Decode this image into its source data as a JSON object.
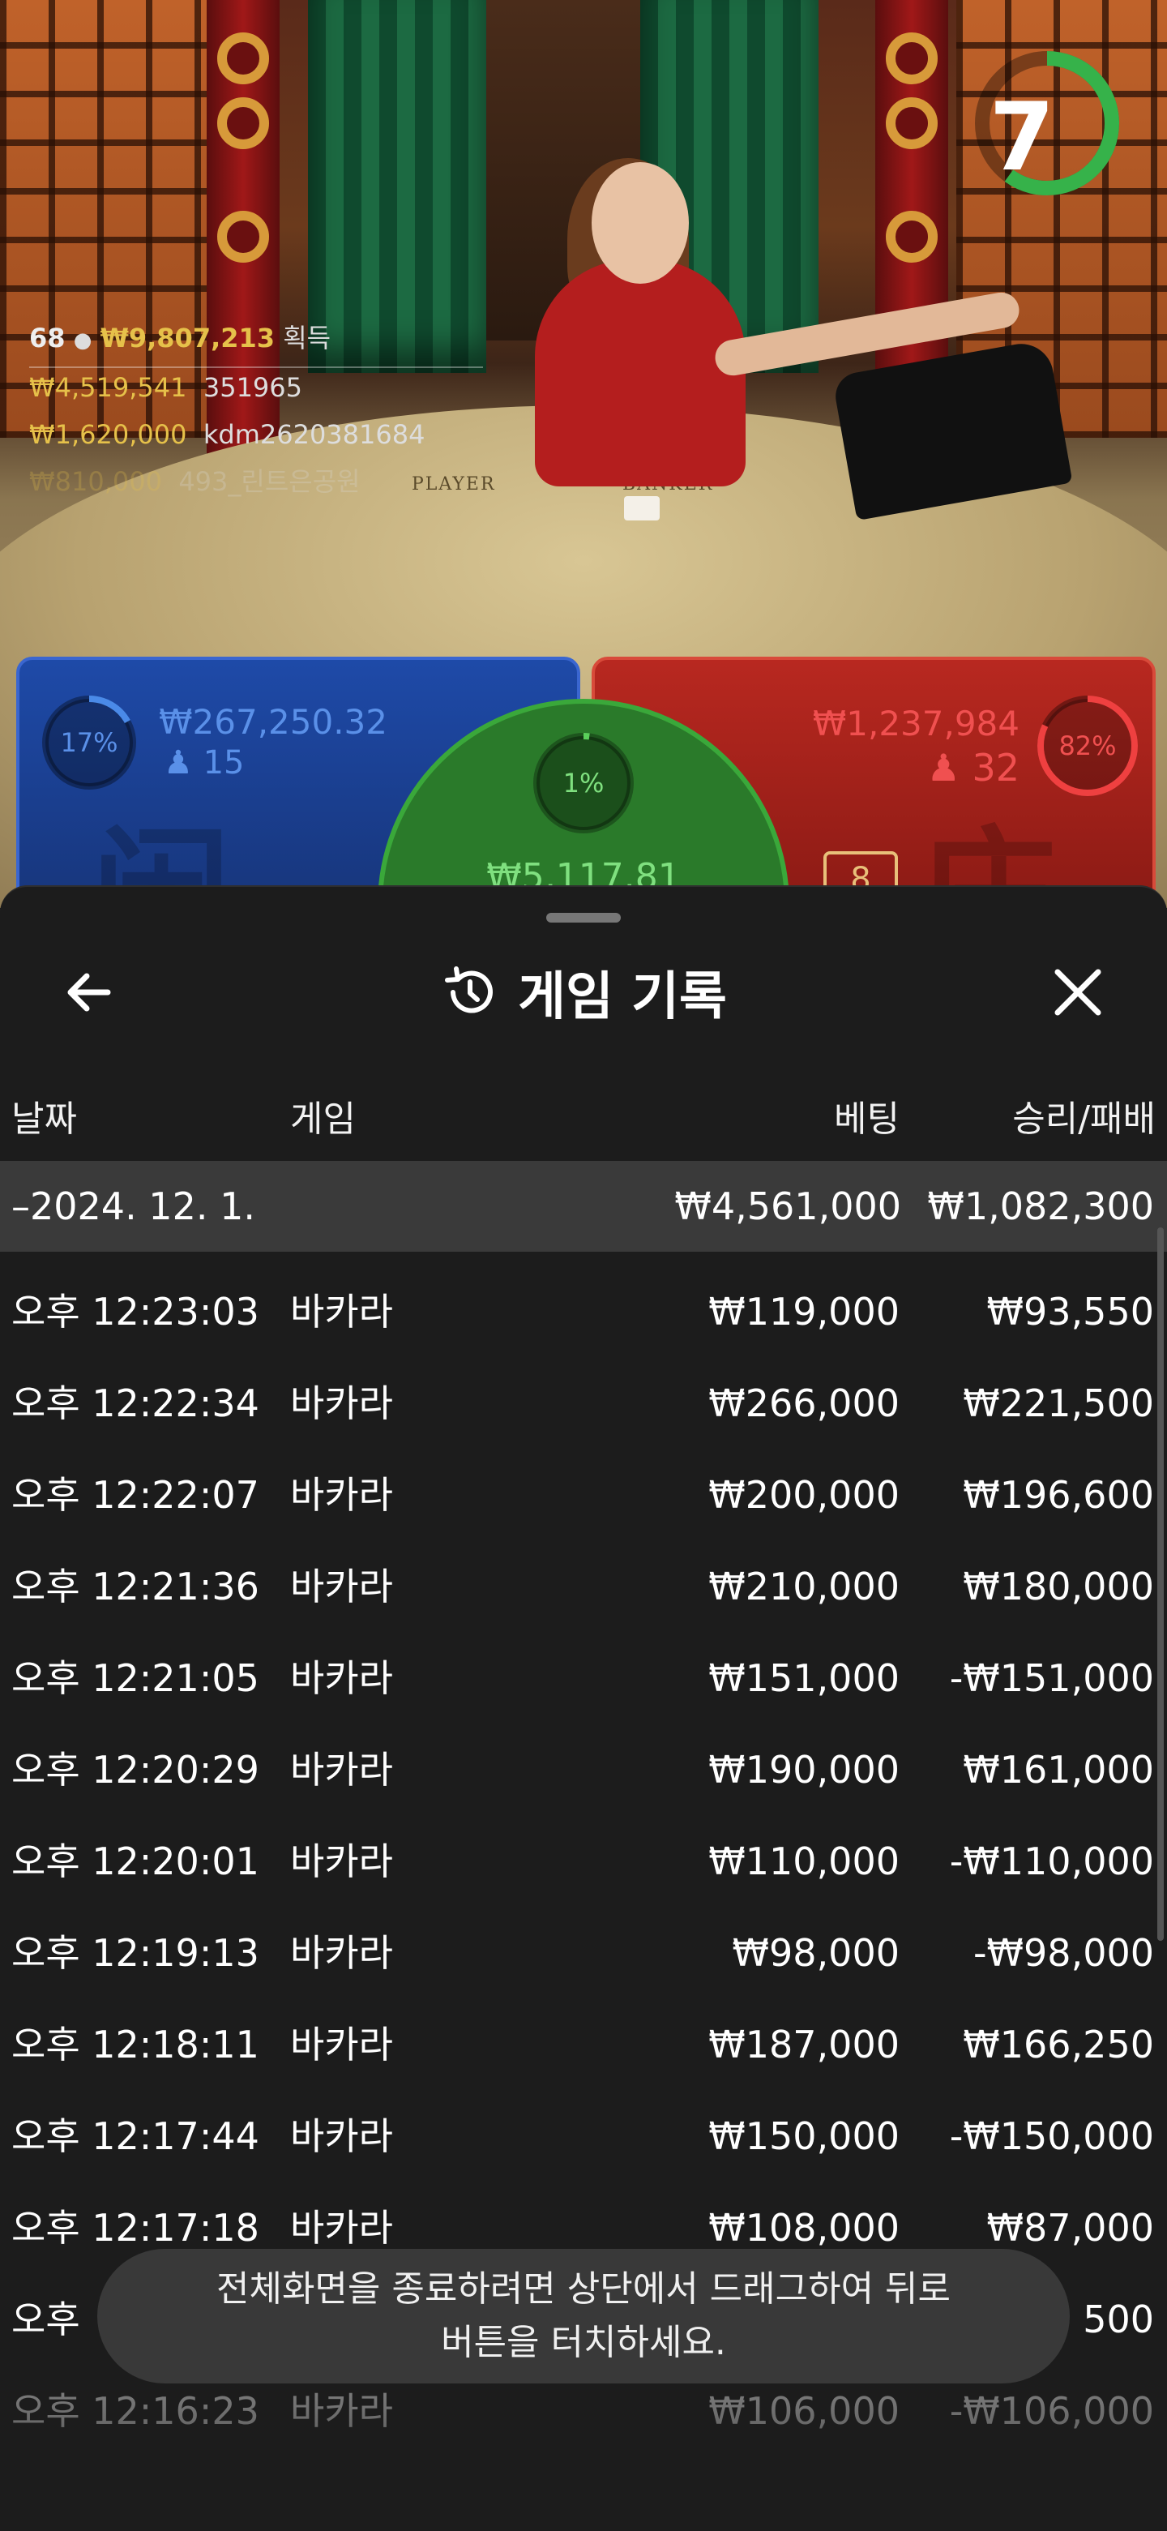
{
  "game_overlay": {
    "timer": "7",
    "timer_fraction": 0.6,
    "winners": {
      "count": "68",
      "total": "₩9,807,213",
      "label": "획득",
      "entries": [
        {
          "amount": "₩4,519,541",
          "name": "351965"
        },
        {
          "amount": "₩1,620,000",
          "name": "kdm2620381684"
        },
        {
          "amount": "₩810,000",
          "name": "493_린트은공원"
        }
      ]
    },
    "table_labels": {
      "player": "PLAYER",
      "banker": "BANKER"
    },
    "player": {
      "percent": "17%",
      "percent_value": 0.17,
      "amount": "₩267,250.32",
      "players": "15"
    },
    "tie": {
      "percent": "1%",
      "percent_value": 0.01,
      "amount": "₩5,117.81"
    },
    "banker": {
      "percent": "82%",
      "percent_value": 0.82,
      "amount": "₩1,237,984",
      "players": "32"
    }
  },
  "sheet": {
    "title": "게임 기록",
    "columns": {
      "date": "날짜",
      "game": "게임",
      "bet": "베팅",
      "result": "승리/패배"
    },
    "summary": {
      "date": "–2024. 12. 1.",
      "bet": "₩4,561,000",
      "result": "₩1,082,300"
    },
    "rows": [
      {
        "time": "오후 12:23:03",
        "game": "바카라",
        "bet": "₩119,000",
        "result": "₩93,550"
      },
      {
        "time": "오후 12:22:34",
        "game": "바카라",
        "bet": "₩266,000",
        "result": "₩221,500"
      },
      {
        "time": "오후 12:22:07",
        "game": "바카라",
        "bet": "₩200,000",
        "result": "₩196,600"
      },
      {
        "time": "오후 12:21:36",
        "game": "바카라",
        "bet": "₩210,000",
        "result": "₩180,000"
      },
      {
        "time": "오후 12:21:05",
        "game": "바카라",
        "bet": "₩151,000",
        "result": "-₩151,000"
      },
      {
        "time": "오후 12:20:29",
        "game": "바카라",
        "bet": "₩190,000",
        "result": "₩161,000"
      },
      {
        "time": "오후 12:20:01",
        "game": "바카라",
        "bet": "₩110,000",
        "result": "-₩110,000"
      },
      {
        "time": "오후 12:19:13",
        "game": "바카라",
        "bet": "₩98,000",
        "result": "-₩98,000"
      },
      {
        "time": "오후 12:18:11",
        "game": "바카라",
        "bet": "₩187,000",
        "result": "₩166,250"
      },
      {
        "time": "오후 12:17:44",
        "game": "바카라",
        "bet": "₩150,000",
        "result": "-₩150,000"
      },
      {
        "time": "오후 12:17:18",
        "game": "바카라",
        "bet": "₩108,000",
        "result": "₩87,000"
      },
      {
        "time": "오후",
        "game": "",
        "bet": "",
        "result": "500"
      },
      {
        "time": "오후 12:16:23",
        "game": "바카라",
        "bet": "₩106,000",
        "result": "-₩106,000"
      }
    ]
  },
  "toast": {
    "line1": "전체화면을 종료하려면 상단에서 드래그하여 뒤로",
    "line2": "버튼을 터치하세요."
  }
}
